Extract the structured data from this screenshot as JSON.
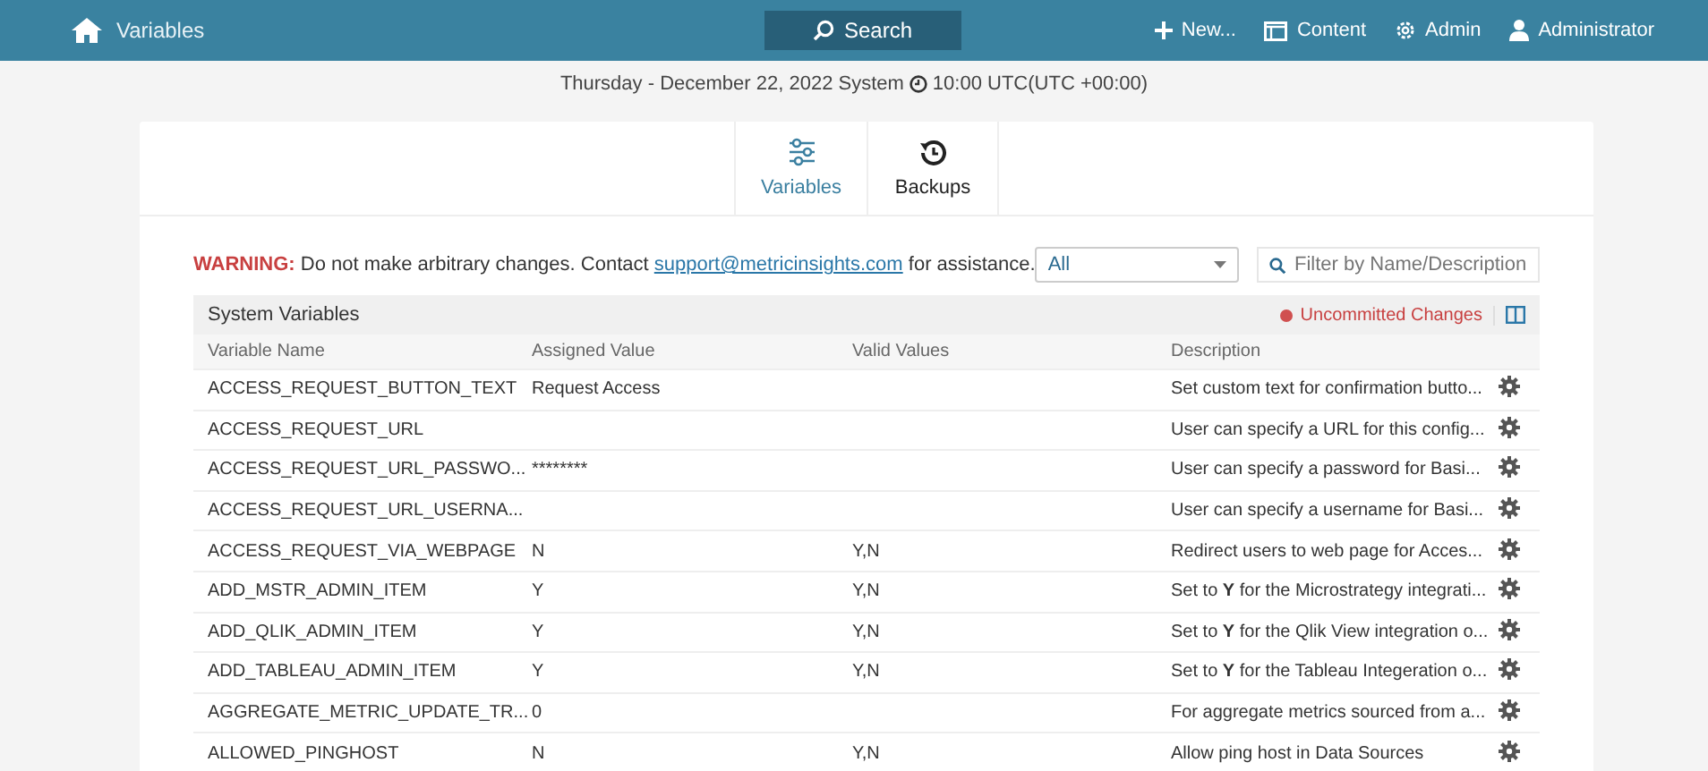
{
  "navbar": {
    "title": "Variables",
    "search": "Search",
    "actions": [
      {
        "kind": "new",
        "label": "New..."
      },
      {
        "kind": "content",
        "label": "Content"
      },
      {
        "kind": "admin",
        "label": "Admin"
      },
      {
        "kind": "user",
        "label": "Administrator"
      }
    ]
  },
  "date_line": "Thursday - December 22, 2022 System",
  "time": "10:00 UTC(UTC +00:00)",
  "tabs": [
    {
      "kind": "variables",
      "label": "Variables",
      "selected": true
    },
    {
      "kind": "backups",
      "label": "Backups",
      "selected": false
    }
  ],
  "warning": {
    "label": "WARNING:",
    "text": "Do not make arbitrary changes. Contact",
    "link": "support@metricinsights.com",
    "after": "for assistance."
  },
  "filter_select": {
    "value": "All"
  },
  "filter": {
    "placeholder": "Filter by Name/Description"
  },
  "table": {
    "title": "System Variables",
    "status": "Uncommitted Changes",
    "columns": [
      "Variable Name",
      "Assigned Value",
      "Valid Values",
      "Description"
    ],
    "rows": [
      [
        "ACCESS_REQUEST_BUTTON_TEXT",
        "Request Access",
        "",
        "Set custom text for confirmation butto..."
      ],
      [
        "ACCESS_REQUEST_URL",
        "",
        "",
        "User can specify a URL for this config..."
      ],
      [
        "ACCESS_REQUEST_URL_PASSWO...",
        "********",
        "",
        "User can specify a password for Basi..."
      ],
      [
        "ACCESS_REQUEST_URL_USERNA...",
        "",
        "",
        "User can specify a username for Basi..."
      ],
      [
        "ACCESS_REQUEST_VIA_WEBPAGE",
        "N",
        "Y,N",
        "Redirect users to web page for Acces..."
      ],
      [
        "ADD_MSTR_ADMIN_ITEM",
        "Y",
        "Y,N",
        "Set to **Y** for the Microstrategy integrati..."
      ],
      [
        "ADD_QLIK_ADMIN_ITEM",
        "Y",
        "Y,N",
        "Set to **Y** for the Qlik View integration o..."
      ],
      [
        "ADD_TABLEAU_ADMIN_ITEM",
        "Y",
        "Y,N",
        "Set to **Y** for the Tableau Integeration o..."
      ],
      [
        "AGGREGATE_METRIC_UPDATE_TR...",
        "0",
        "",
        "For aggregate metrics sourced from a..."
      ],
      [
        "ALLOWED_PINGHOST",
        "N",
        "Y,N",
        "Allow ping host in Data Sources"
      ]
    ]
  }
}
